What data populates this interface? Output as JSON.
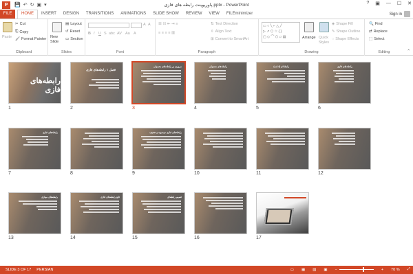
{
  "titlebar": {
    "app_icon": "P",
    "title": "پاورپوینت رابطه های فازی.pptx - PowerPoint",
    "help": "?",
    "ribbon_display": "▣",
    "minimize": "—",
    "maximize": "☐",
    "close": "✕"
  },
  "tabs": [
    {
      "label": "FILE"
    },
    {
      "label": "HOME"
    },
    {
      "label": "INSERT"
    },
    {
      "label": "DESIGN"
    },
    {
      "label": "TRANSITIONS"
    },
    {
      "label": "ANIMATIONS"
    },
    {
      "label": "SLIDE SHOW"
    },
    {
      "label": "REVIEW"
    },
    {
      "label": "VIEW"
    },
    {
      "label": "FILEminimizer"
    }
  ],
  "signin": "Sign in",
  "ribbon": {
    "clipboard": {
      "paste": "Paste",
      "cut": "Cut",
      "copy": "Copy",
      "format_painter": "Format Painter",
      "label": "Clipboard"
    },
    "slides": {
      "new_slide": "New",
      "new_slide2": "Slide",
      "layout": "Layout",
      "reset": "Reset",
      "section": "Section",
      "label": "Slides"
    },
    "font": {
      "label": "Font",
      "bold": "B",
      "italic": "I",
      "underline": "U",
      "strike": "S",
      "shadow": "abc",
      "spacing": "AV",
      "case": "Aa",
      "grow": "A",
      "shrink": "A",
      "clear": "A"
    },
    "paragraph": {
      "text_direction": "Text Direction",
      "align_text": "Align Text",
      "convert": "Convert to SmartArt",
      "label": "Paragraph"
    },
    "drawing": {
      "arrange": "Arrange",
      "quick": "Quick",
      "styles": "Styles",
      "shape_fill": "Shape Fill",
      "shape_outline": "Shape Outline",
      "shape_effects": "Shape Effects",
      "label": "Drawing"
    },
    "editing": {
      "find": "Find",
      "replace": "Replace",
      "select": "Select",
      "label": "Editing"
    }
  },
  "slides": [
    {
      "num": "1",
      "title": "رابطه‌های فازی"
    },
    {
      "num": "2",
      "title": "فصل ۱ رابطه‌های فازی"
    },
    {
      "num": "3",
      "title": "مروری بر رابطه‌های معمولی"
    },
    {
      "num": "4",
      "title": "رابطه‌های معمولی"
    },
    {
      "num": "5",
      "title": "رابطه‌ای (ادامه)"
    },
    {
      "num": "6",
      "title": "رابطه‌های فازی"
    },
    {
      "num": "7",
      "title": "رابطه‌های فازی"
    },
    {
      "num": "8",
      "title": ""
    },
    {
      "num": "9",
      "title": "رابطه‌های فازی دوسویه و ضعیف"
    },
    {
      "num": "10",
      "title": ""
    },
    {
      "num": "11",
      "title": ""
    },
    {
      "num": "12",
      "title": ""
    },
    {
      "num": "13",
      "title": "رابطه‌های موازی"
    },
    {
      "num": "14",
      "title": "تابع رابطه‌های فازی"
    },
    {
      "num": "15",
      "title": "تعمیم رابطه‌ای"
    },
    {
      "num": "16",
      "title": ""
    },
    {
      "num": "17",
      "title": ""
    }
  ],
  "status": {
    "slide": "SLIDE 3 OF 17",
    "language": "PERSIAN",
    "zoom": "70 %",
    "zoom_minus": "−",
    "zoom_plus": "+"
  },
  "colors": {
    "accent": "#d24726",
    "selected_border": "#d24726"
  }
}
